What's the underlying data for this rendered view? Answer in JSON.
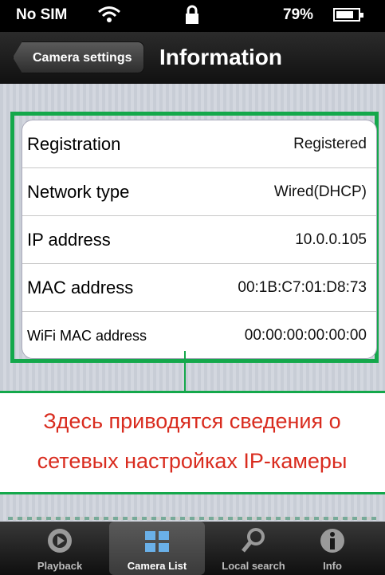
{
  "status_bar": {
    "carrier": "No SIM",
    "battery_percent": "79%",
    "battery_level": 0.79
  },
  "nav": {
    "back_label": "Camera settings",
    "title": "Information"
  },
  "info_rows": [
    {
      "label": "Registration",
      "value": "Registered"
    },
    {
      "label": "Network type",
      "value": "Wired(DHCP)"
    },
    {
      "label": "IP address",
      "value": "10.0.0.105"
    },
    {
      "label": "MAC address",
      "value": "00:1B:C7:01:D8:73"
    },
    {
      "label": "WiFi MAC address",
      "value": "00:00:00:00:00:00"
    }
  ],
  "callout": {
    "line1": "Здесь приводятся сведения о",
    "line2": "сетевых настройках IP-камеры"
  },
  "tabs": [
    {
      "label": "Playback",
      "icon": "playback-icon",
      "active": false
    },
    {
      "label": "Camera List",
      "icon": "camera-list-icon",
      "active": true
    },
    {
      "label": "Local search",
      "icon": "search-icon",
      "active": false
    },
    {
      "label": "Info",
      "icon": "info-icon",
      "active": false
    }
  ],
  "colors": {
    "highlight": "#14a84b",
    "callout_text": "#d92c1f"
  }
}
